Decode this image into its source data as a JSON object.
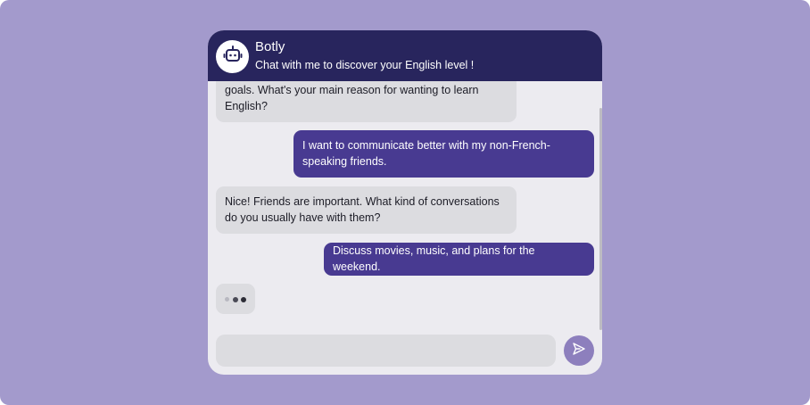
{
  "header": {
    "title": "Botly",
    "subtitle": "Chat with me to discover your English level !",
    "avatar_icon": "robot-icon",
    "background": "#28255d"
  },
  "messages": [
    {
      "role": "bot",
      "text": "goals. What's your main reason for wanting to learn English?"
    },
    {
      "role": "user",
      "text": "I want to communicate better with my non-French-speaking friends."
    },
    {
      "role": "bot",
      "text": "Nice! Friends are important. What kind of conversations do you usually have with them?"
    },
    {
      "role": "user",
      "text": "Discuss movies, music, and plans for the weekend."
    }
  ],
  "typing_indicator": {
    "icon": "typing-dots-icon"
  },
  "composer": {
    "value": "",
    "placeholder": "",
    "send_icon": "send-icon"
  },
  "colors": {
    "page_background": "#a39acc",
    "user_bubble": "#483a91",
    "bot_bubble": "#dcdce0",
    "send_button": "#8d7fbd"
  }
}
